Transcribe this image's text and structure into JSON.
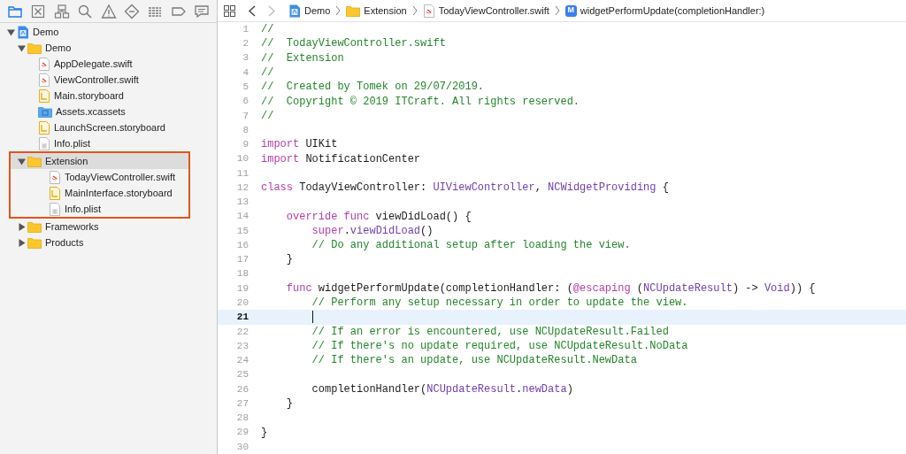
{
  "navigator_tabs": [
    {
      "kind": "project",
      "selected": true
    },
    {
      "kind": "source_control",
      "selected": false
    },
    {
      "kind": "symbol",
      "selected": false
    },
    {
      "kind": "find",
      "selected": false
    },
    {
      "kind": "issue",
      "selected": false
    },
    {
      "kind": "test",
      "selected": false
    },
    {
      "kind": "debug",
      "selected": false
    },
    {
      "kind": "breakpoint",
      "selected": false
    },
    {
      "kind": "report",
      "selected": false
    }
  ],
  "project_tree": [
    {
      "kind": "project",
      "label": "Demo",
      "expanded": true,
      "selected": false,
      "outlined": false,
      "children": [
        {
          "kind": "folder",
          "label": "Demo",
          "expanded": true,
          "selected": false,
          "outlined": false,
          "children": [
            {
              "kind": "swift",
              "label": "AppDelegate.swift",
              "selected": false,
              "outlined": false
            },
            {
              "kind": "swift",
              "label": "ViewController.swift",
              "selected": false,
              "outlined": false
            },
            {
              "kind": "storyboard",
              "label": "Main.storyboard",
              "selected": false,
              "outlined": false
            },
            {
              "kind": "assets",
              "label": "Assets.xcassets",
              "selected": false,
              "outlined": false
            },
            {
              "kind": "storyboard",
              "label": "LaunchScreen.storyboard",
              "selected": false,
              "outlined": false
            },
            {
              "kind": "plist",
              "label": "Info.plist",
              "selected": false,
              "outlined": false
            }
          ]
        },
        {
          "kind": "folder",
          "label": "Extension",
          "expanded": true,
          "selected": true,
          "outlined": true,
          "children": [
            {
              "kind": "swift",
              "label": "TodayViewController.swift",
              "selected": false,
              "outlined": false
            },
            {
              "kind": "storyboard",
              "label": "MainInterface.storyboard",
              "selected": false,
              "outlined": false
            },
            {
              "kind": "plist",
              "label": "Info.plist",
              "selected": false,
              "outlined": false
            }
          ]
        },
        {
          "kind": "folder",
          "label": "Frameworks",
          "expanded": false,
          "selected": false,
          "outlined": false
        },
        {
          "kind": "folder",
          "label": "Products",
          "expanded": false,
          "selected": false,
          "outlined": false
        }
      ]
    }
  ],
  "editor_nav": {
    "back_enabled": true,
    "forward_enabled": false
  },
  "breadcrumbs": [
    {
      "kind": "project",
      "label": "Demo"
    },
    {
      "kind": "folder",
      "label": "Extension"
    },
    {
      "kind": "swift",
      "label": "TodayViewController.swift"
    },
    {
      "kind": "method",
      "badge": "M",
      "label": "widgetPerformUpdate(completionHandler:)"
    }
  ],
  "code_lines": [
    {
      "number": "1",
      "current": false,
      "tokens": [
        {
          "kind": "comment",
          "text": "//"
        }
      ]
    },
    {
      "number": "2",
      "current": false,
      "tokens": [
        {
          "kind": "comment",
          "text": "//  TodayViewController.swift"
        }
      ]
    },
    {
      "number": "3",
      "current": false,
      "tokens": [
        {
          "kind": "comment",
          "text": "//  Extension"
        }
      ]
    },
    {
      "number": "4",
      "current": false,
      "tokens": [
        {
          "kind": "comment",
          "text": "//"
        }
      ]
    },
    {
      "number": "5",
      "current": false,
      "tokens": [
        {
          "kind": "comment",
          "text": "//  Created by Tomek on 29/07/2019."
        }
      ]
    },
    {
      "number": "6",
      "current": false,
      "tokens": [
        {
          "kind": "comment",
          "text": "//  Copyright © 2019 ITCraft. All rights reserved."
        }
      ]
    },
    {
      "number": "7",
      "current": false,
      "tokens": [
        {
          "kind": "comment",
          "text": "//"
        }
      ]
    },
    {
      "number": "8",
      "current": false
    },
    {
      "number": "9",
      "current": false,
      "tokens": [
        {
          "kind": "keyword",
          "text": "import"
        },
        {
          "kind": "plain",
          "text": " UIKit"
        }
      ]
    },
    {
      "number": "10",
      "current": false,
      "tokens": [
        {
          "kind": "keyword",
          "text": "import"
        },
        {
          "kind": "plain",
          "text": " NotificationCenter"
        }
      ]
    },
    {
      "number": "11",
      "current": false
    },
    {
      "number": "12",
      "current": false,
      "tokens": [
        {
          "kind": "keyword",
          "text": "class"
        },
        {
          "kind": "plain",
          "text": " TodayViewController: "
        },
        {
          "kind": "type",
          "text": "UIViewController"
        },
        {
          "kind": "plain",
          "text": ", "
        },
        {
          "kind": "type",
          "text": "NCWidgetProviding"
        },
        {
          "kind": "plain",
          "text": " {"
        }
      ]
    },
    {
      "number": "13",
      "current": false
    },
    {
      "number": "14",
      "current": false,
      "tokens": [
        {
          "kind": "keyword",
          "text": "    override func"
        },
        {
          "kind": "plain",
          "text": " viewDidLoad() {"
        }
      ]
    },
    {
      "number": "15",
      "current": false,
      "tokens": [
        {
          "kind": "keyword",
          "text": "        super"
        },
        {
          "kind": "plain",
          "text": "."
        },
        {
          "kind": "type",
          "text": "viewDidLoad"
        },
        {
          "kind": "plain",
          "text": "()"
        }
      ]
    },
    {
      "number": "16",
      "current": false,
      "tokens": [
        {
          "kind": "comment",
          "text": "        // Do any additional setup after loading the view."
        }
      ]
    },
    {
      "number": "17",
      "current": false,
      "tokens": [
        {
          "kind": "plain",
          "text": "    }"
        }
      ]
    },
    {
      "number": "18",
      "current": false
    },
    {
      "number": "19",
      "current": false,
      "tokens": [
        {
          "kind": "keyword",
          "text": "    func"
        },
        {
          "kind": "plain",
          "text": " widgetPerformUpdate(completionHandler: ("
        },
        {
          "kind": "keyword",
          "text": "@escaping"
        },
        {
          "kind": "plain",
          "text": " ("
        },
        {
          "kind": "type",
          "text": "NCUpdateResult"
        },
        {
          "kind": "plain",
          "text": ") -> "
        },
        {
          "kind": "type",
          "text": "Void"
        },
        {
          "kind": "plain",
          "text": ")) {"
        }
      ]
    },
    {
      "number": "20",
      "current": false,
      "tokens": [
        {
          "kind": "comment",
          "text": "        // Perform any setup necessary in order to update the view."
        }
      ]
    },
    {
      "number": "21",
      "current": true
    },
    {
      "number": "22",
      "current": false,
      "tokens": [
        {
          "kind": "comment",
          "text": "        // If an error is encountered, use NCUpdateResult.Failed"
        }
      ]
    },
    {
      "number": "23",
      "current": false,
      "tokens": [
        {
          "kind": "comment",
          "text": "        // If there's no update required, use NCUpdateResult.NoData"
        }
      ]
    },
    {
      "number": "24",
      "current": false,
      "tokens": [
        {
          "kind": "comment",
          "text": "        // If there's an update, use NCUpdateResult.NewData"
        }
      ]
    },
    {
      "number": "25",
      "current": false
    },
    {
      "number": "26",
      "current": false,
      "tokens": [
        {
          "kind": "plain",
          "text": "        completionHandler("
        },
        {
          "kind": "type",
          "text": "NCUpdateResult"
        },
        {
          "kind": "plain",
          "text": "."
        },
        {
          "kind": "type",
          "text": "newData"
        },
        {
          "kind": "plain",
          "text": ")"
        }
      ]
    },
    {
      "number": "27",
      "current": false,
      "tokens": [
        {
          "kind": "plain",
          "text": "    }"
        }
      ]
    },
    {
      "number": "28",
      "current": false
    },
    {
      "number": "29",
      "current": false,
      "tokens": [
        {
          "kind": "plain",
          "text": "}"
        }
      ]
    },
    {
      "number": "30",
      "current": false
    }
  ]
}
